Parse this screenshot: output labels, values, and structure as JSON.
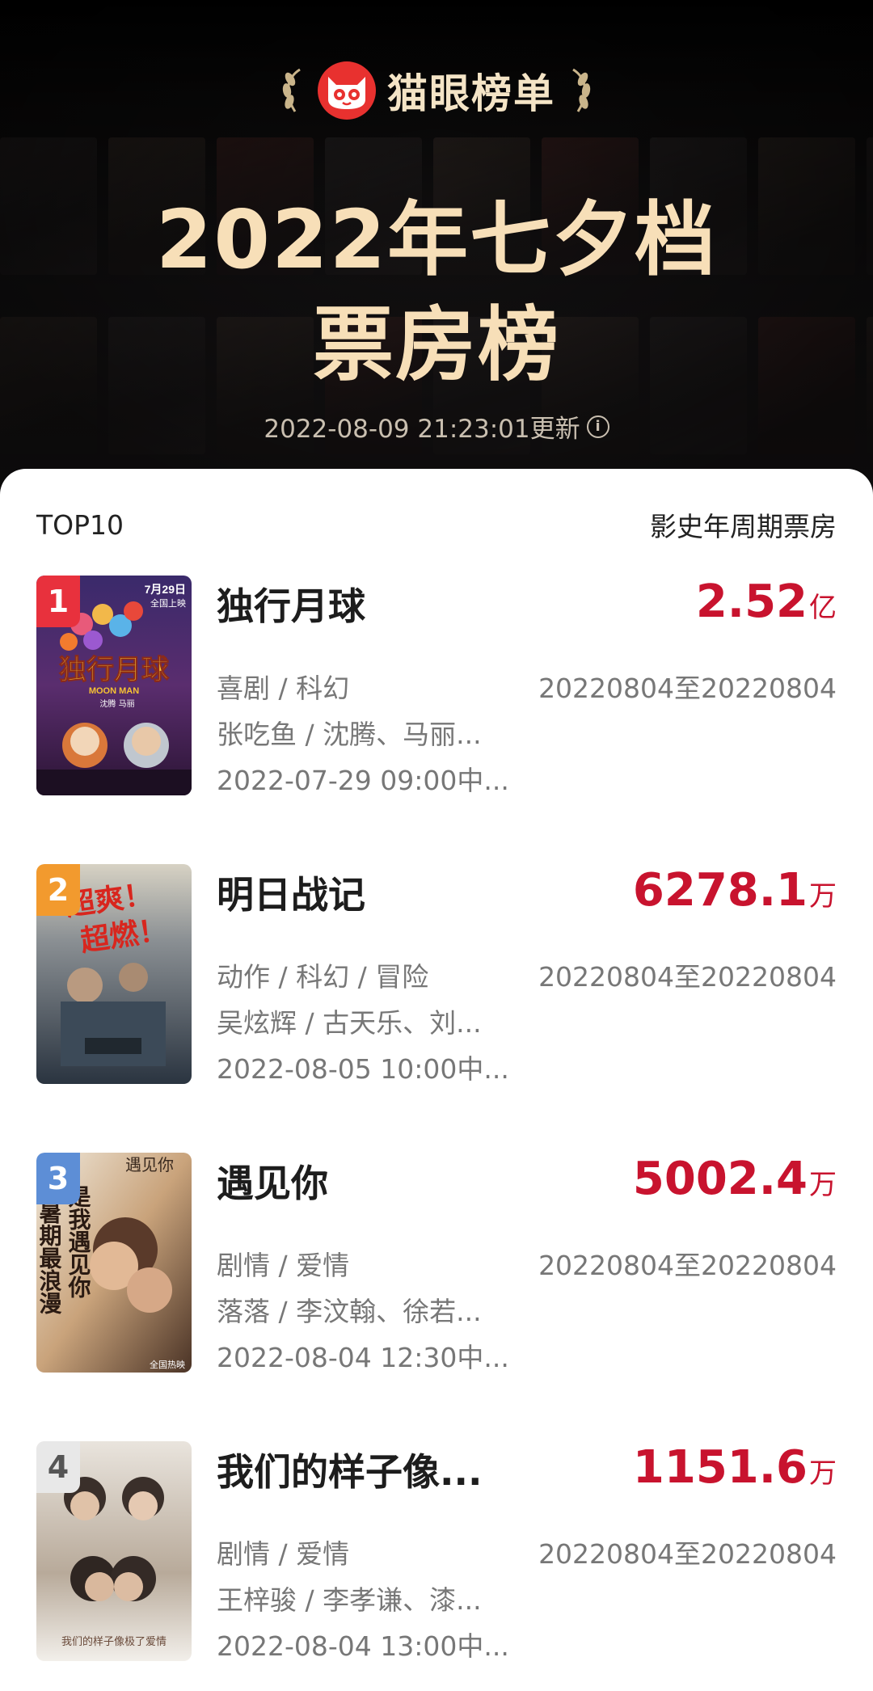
{
  "header": {
    "brand_name": "猫眼榜单",
    "title_line1": "2022年七夕档",
    "title_line2": "票房榜",
    "updated_text": "2022-08-09 21:23:01更新",
    "info_icon": "info-icon"
  },
  "list": {
    "top_label": "TOP10",
    "right_label": "影史年周期票房",
    "items": [
      {
        "rank": "1",
        "title": "独行月球",
        "box_office_value": "2.52",
        "box_office_unit": "亿",
        "genre": "喜剧 / 科幻",
        "period": "20220804至20220804",
        "cast": "张吃鱼 / 沈腾、马丽...",
        "release": "2022-07-29 09:00中...",
        "poster_text_date": "7月29日",
        "poster_text_sub": "全国上映",
        "poster_text_title": "独行月球",
        "poster_text_en": "MOON MAN",
        "poster_text_names": "沈腾  马丽"
      },
      {
        "rank": "2",
        "title": "明日战记",
        "box_office_value": "6278.1",
        "box_office_unit": "万",
        "genre": "动作 / 科幻 / 冒险",
        "period": "20220804至20220804",
        "cast": "吴炫辉 / 古天乐、刘...",
        "release": "2022-08-05 10:00中...",
        "poster_text_1": "超爽！",
        "poster_text_2": "超燃！"
      },
      {
        "rank": "3",
        "title": "遇见你",
        "box_office_value": "5002.4",
        "box_office_unit": "万",
        "genre": "剧情 / 爱情",
        "period": "20220804至20220804",
        "cast": "落落 / 李汶翰、徐若...",
        "release": "2022-08-04 12:30中...",
        "poster_text_logo": "遇见你",
        "poster_text_left": "暑期最浪漫",
        "poster_text_right": "是我遇见你",
        "poster_text_bottom": "全国热映"
      },
      {
        "rank": "4",
        "title": "我们的样子像...",
        "box_office_value": "1151.6",
        "box_office_unit": "万",
        "genre": "剧情 / 爱情",
        "period": "20220804至20220804",
        "cast": "王梓骏 / 李孝谦、漆...",
        "release": "2022-08-04 13:00中...",
        "poster_text_bottom": "我们的样子像极了爱情"
      }
    ]
  }
}
